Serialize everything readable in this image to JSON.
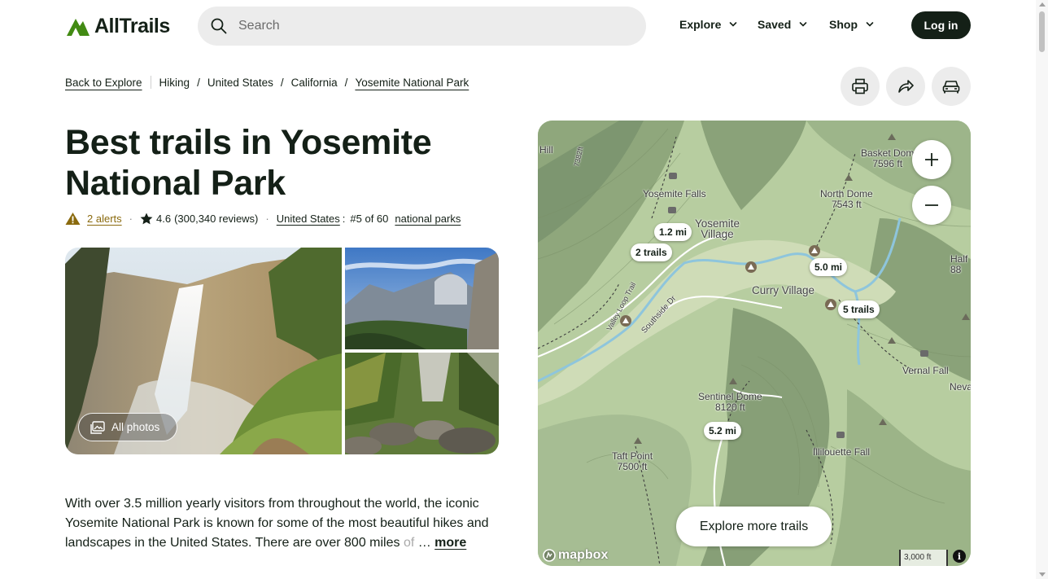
{
  "brand": {
    "name": "AllTrails",
    "accent": "#428a13",
    "dark": "#142017"
  },
  "search": {
    "placeholder": "Search"
  },
  "nav": {
    "items": [
      {
        "label": "Explore"
      },
      {
        "label": "Saved"
      },
      {
        "label": "Shop"
      }
    ],
    "login": "Log in"
  },
  "breadcrumb": {
    "back": "Back to Explore",
    "items": [
      "Hiking",
      "United States",
      "California",
      "Yosemite National Park"
    ],
    "separator": "/"
  },
  "actions": [
    "print-icon",
    "share-icon",
    "car-icon"
  ],
  "page": {
    "title": "Best trails in Yosemite National Park",
    "alerts": "2 alerts",
    "rating": "4.6",
    "reviews": "(300,340 reviews)",
    "country": "United States",
    "rank_sep": ":",
    "rank": "#5 of 60",
    "category": "national parks",
    "dot": "·"
  },
  "photos": {
    "button": "All photos"
  },
  "description": {
    "text": "With over 3.5 million yearly visitors from throughout the world, the iconic Yosemite National Park is known for some of the most beautiful hikes and landscapes in the United States. There are over 800 miles ",
    "faded": "of",
    "ellipsis": " … ",
    "more": "more"
  },
  "map": {
    "labels": {
      "hill": "Hill",
      "road1": "7382ft",
      "yosemite_falls": "Yosemite Falls",
      "yosemite_village": "Yosemite\nVillage",
      "basket_dome": "Basket Dom\n7596 ft",
      "north_dome": "North Dome\n7543 ft",
      "half": "Half\n88",
      "curry_village": "Curry Village",
      "valley_loop": "Valley Loop Trail",
      "southside": "Southside Dr",
      "vernal_fall": "Vernal Fall",
      "neva": "Neva",
      "sentinel_dome": "Sentinel Dome\n8120 ft",
      "taft_point": "Taft Point\n7500 ft",
      "illilouette": "Illilouette Fall"
    },
    "pills": {
      "p1": "1.2 mi",
      "p2": "2 trails",
      "p3": "5.0 mi",
      "p4": "5 trails",
      "p5": "5.2 mi"
    },
    "explore": "Explore more trails",
    "mapbox": "mapbox",
    "scale": "3,000 ft",
    "info": "i"
  }
}
